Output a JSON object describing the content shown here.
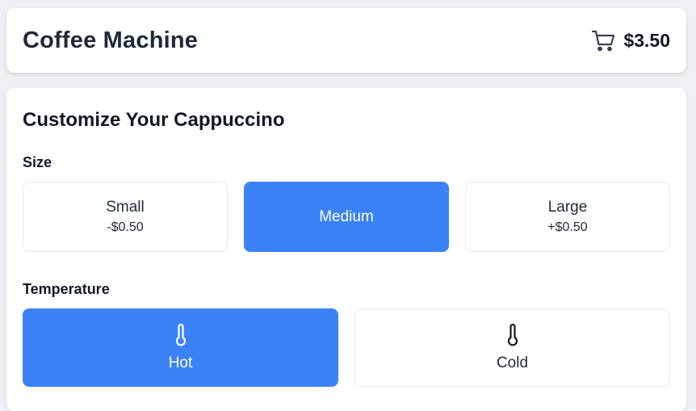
{
  "header": {
    "title": "Coffee Machine",
    "cart_icon": "cart-icon",
    "cart_total": "$3.50"
  },
  "customize": {
    "title": "Customize Your Cappuccino",
    "size_label": "Size",
    "sizes": [
      {
        "name": "Small",
        "price": "-$0.50",
        "selected": false
      },
      {
        "name": "Medium",
        "price": "",
        "selected": true
      },
      {
        "name": "Large",
        "price": "+$0.50",
        "selected": false
      }
    ],
    "temperature_label": "Temperature",
    "temperatures": [
      {
        "name": "Hot",
        "icon": "thermometer-icon",
        "selected": true
      },
      {
        "name": "Cold",
        "icon": "thermometer-icon",
        "selected": false
      }
    ]
  },
  "colors": {
    "accent": "#3b82f6",
    "background": "#eef0f3",
    "card": "#ffffff",
    "border": "#e5e7eb"
  }
}
